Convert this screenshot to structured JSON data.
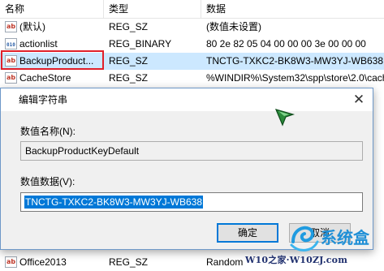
{
  "columns": {
    "name": "名称",
    "type": "类型",
    "data": "数据"
  },
  "rows": [
    {
      "icon": "string-value-icon",
      "name": "(默认)",
      "type": "REG_SZ",
      "data": "(数值未设置)",
      "selected": false
    },
    {
      "icon": "binary-value-icon",
      "name": "actionlist",
      "type": "REG_BINARY",
      "data": "80 2e 82 05 04 00 00 00 3e 00 00 00",
      "selected": false
    },
    {
      "icon": "string-value-icon",
      "name": "BackupProduct...",
      "type": "REG_SZ",
      "data": "TNCTG-TXKC2-BK8W3-MW3YJ-WB638",
      "selected": true
    },
    {
      "icon": "string-value-icon",
      "name": "CacheStore",
      "type": "REG_SZ",
      "data": "%WINDIR%\\System32\\spp\\store\\2.0\\cach",
      "selected": false
    },
    {
      "icon": "string-value-icon",
      "name": "Office2013",
      "type": "REG_SZ",
      "data": "Random",
      "selected": false
    }
  ],
  "dialog": {
    "title": "编辑字符串",
    "close_glyph": "✕",
    "name_label": "数值名称(N):",
    "name_value": "BackupProductKeyDefault",
    "data_label": "数值数据(V):",
    "data_value": "TNCTG-TXKC2-BK8W3-MW3YJ-WB638",
    "ok_label": "确定",
    "cancel_label": "取消"
  },
  "icon_glyph": "ab",
  "watermark": {
    "logo_text": "系统盒",
    "url_text": "W10之家·W10ZJ.com"
  },
  "colors": {
    "selection": "#cce8ff",
    "highlight_frame": "#e0202a",
    "text_selection": "#0078d7",
    "ok_border": "#0078d7"
  }
}
